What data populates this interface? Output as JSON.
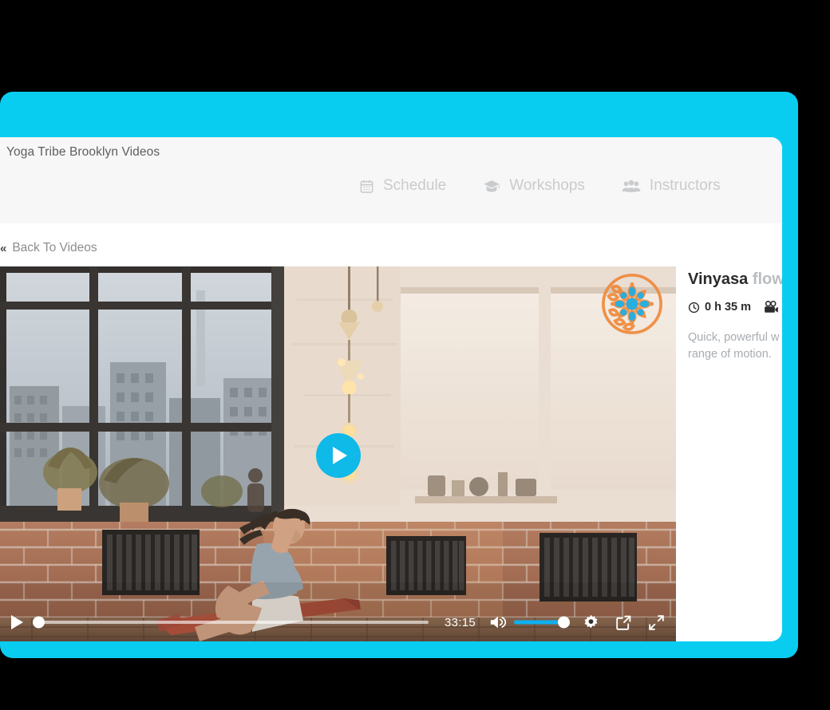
{
  "theme": {
    "accent_cyan": "#09cdf0",
    "play_button_blue": "#0fb9e8",
    "page_background": "#000000",
    "card_background": "#ffffff",
    "header_background": "#f7f7f7",
    "mandala_orange": "#ef8a3c",
    "mandala_blue": "#18a9e0",
    "nav_text_gray": "#c9cbcd"
  },
  "header": {
    "brand_title": "Yoga Tribe Brooklyn Videos",
    "nav_items": [
      {
        "label": "Schedule",
        "icon": "calendar-icon"
      },
      {
        "label": "Workshops",
        "icon": "graduation-cap-icon"
      },
      {
        "label": "Instructors",
        "icon": "people-group-icon"
      }
    ]
  },
  "back_link": {
    "chevrons": "«",
    "label": "Back To Videos"
  },
  "player": {
    "overlay_play_icon": "play-icon",
    "logo_icon": "mandala-logo-icon",
    "controls": {
      "play_icon": "play-icon",
      "time_label": "33:15",
      "volume_icon": "volume-on-icon",
      "settings_icon": "gear-icon",
      "popout_icon": "picture-in-picture-icon",
      "fullscreen_icon": "expand-icon",
      "seek_progress_percent": 0,
      "volume_percent": 100
    }
  },
  "video_info": {
    "title_strong": "Vinyasa",
    "title_light": "flow",
    "duration": "0 h 35 m",
    "duration_icon": "clock-icon",
    "camera_icon": "video-camera-icon",
    "description_line_1": "Quick, powerful w",
    "description_line_2": "range of motion."
  }
}
